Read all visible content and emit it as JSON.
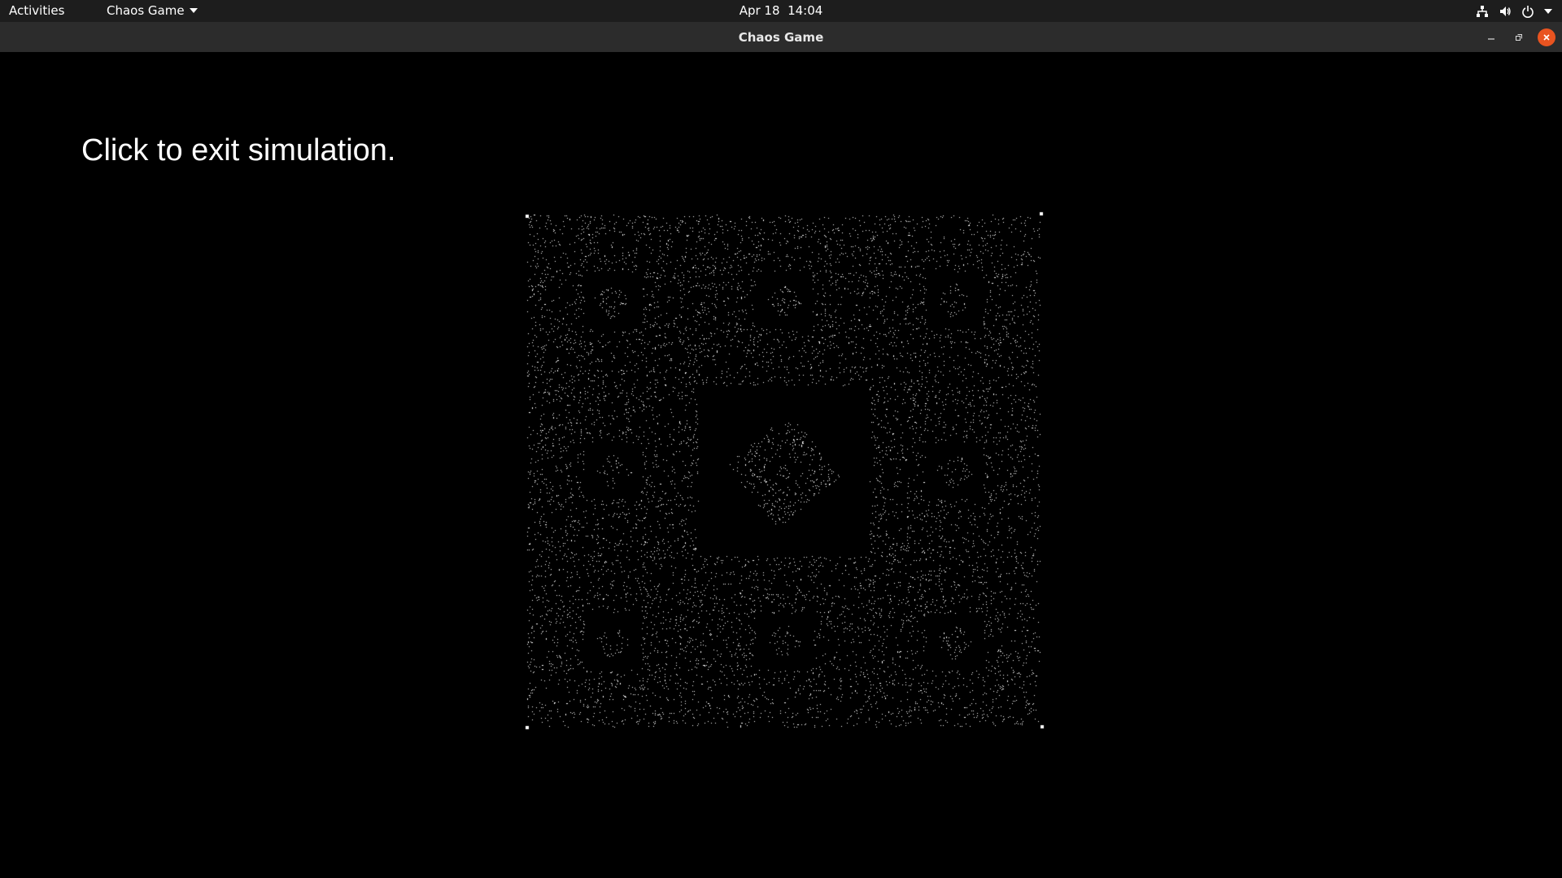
{
  "topbar": {
    "activities": "Activities",
    "app_menu": "Chaos Game",
    "date": "Apr 18",
    "time": "14:04",
    "tray_icons": [
      "network-icon",
      "volume-icon",
      "power-icon",
      "chevron-down-icon"
    ]
  },
  "window": {
    "title": "Chaos Game",
    "controls": [
      "minimize-icon",
      "maximize-icon",
      "close-icon"
    ],
    "close_color": "#e95420"
  },
  "simulation": {
    "message": "Click to exit simulation.",
    "fractal": "Vicsek-like chaos game fractal",
    "vertex_markers": 4,
    "point_color": "#ffffff",
    "background": "#000000"
  }
}
